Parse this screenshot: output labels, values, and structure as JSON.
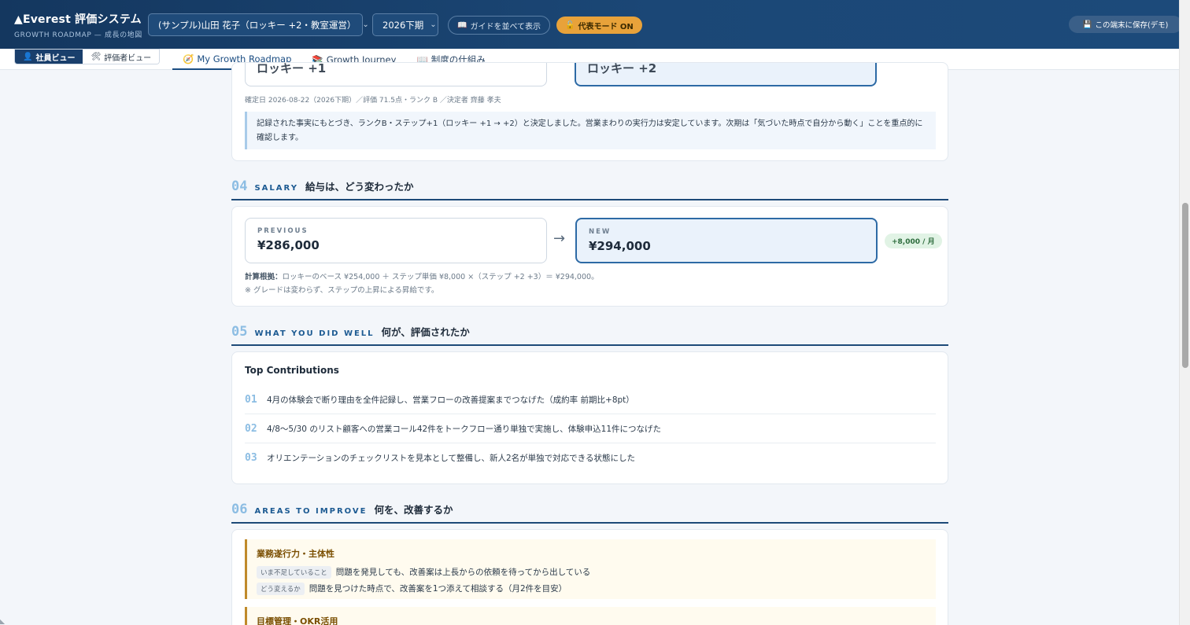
{
  "header": {
    "brand_title": "▲Everest 評価システム",
    "brand_sub": "GROWTH ROADMAP — 成長の地図",
    "employee_select": "(サンプル)山田 花子（ロッキー +2・教室運営）",
    "term_select": "2026下期",
    "guide_button": "ガイドを並べて表示",
    "rep_mode_button": "代表モード ON",
    "save_button": "この端末に保存(デモ)"
  },
  "view_toggle": {
    "employee_view": "社員ビュー",
    "evaluator_view": "評価者ビュー"
  },
  "tabs": [
    {
      "label": "My Growth Roadmap",
      "active": true
    },
    {
      "label": "Growth Journey",
      "active": false
    },
    {
      "label": "制度の仕組み",
      "active": false
    }
  ],
  "rank": {
    "previous_partial": "ロッキー +1",
    "new_partial": "ロッキー +2",
    "fixed_meta": "確定日 2026-08-22（2026下期）／評価 71.5点・ランク B ／決定者 齊藤 孝夫",
    "reason": "記録された事実にもとづき、ランクB・ステップ+1（ロッキー +1 → +2）と決定しました。営業まわりの実行力は安定しています。次期は「気づいた時点で自分から動く」ことを重点的に確認します。"
  },
  "sections": {
    "s04": {
      "num": "04",
      "en": "SALARY",
      "ja": "給与は、どう変わったか"
    },
    "s05": {
      "num": "05",
      "en": "WHAT YOU DID WELL",
      "ja": "何が、評価されたか"
    },
    "s06": {
      "num": "06",
      "en": "AREAS TO IMPROVE",
      "ja": "何を、改善するか"
    }
  },
  "salary": {
    "previous_label": "PREVIOUS",
    "previous_value": "¥286,000",
    "new_label": "NEW",
    "new_value": "¥294,000",
    "arrow": "→",
    "diff": "+8,000 / 月",
    "basis_label": "計算根拠：",
    "basis_text": "ロッキーのベース ¥254,000 ＋ ステップ単価 ¥8,000 ×（ステップ +2 +3）＝ ¥294,000。",
    "note": "※ グレードは変わらず、ステップの上昇による昇給です。"
  },
  "contributions": {
    "title": "Top Contributions",
    "items": [
      {
        "num": "01",
        "text": "4月の体験会で断り理由を全件記録し、営業フローの改善提案までつなげた（成約率 前期比+8pt）"
      },
      {
        "num": "02",
        "text": "4/8〜5/30 のリスト顧客への営業コール42件をトークフロー通り単独で実施し、体験申込11件につなげた"
      },
      {
        "num": "03",
        "text": "オリエンテーションのチェックリストを見本として整備し、新人2名が単独で対応できる状態にした"
      }
    ]
  },
  "improvements": {
    "items": [
      {
        "title": "業務遂行力・主体性",
        "current_tag": "いま不足していること",
        "current_text": "問題を発見しても、改善案は上長からの依頼を待ってから出している",
        "change_tag": "どう変えるか",
        "change_text": "問題を見つけた時点で、改善案を1つ添えて相談する（月2件を目安）"
      },
      {
        "title": "目標管理・OKR活用"
      }
    ]
  },
  "colors": {
    "header_bg": "#14375f",
    "accent": "#1d4a78",
    "rep_mode": "#e8a23a",
    "diff_bg": "#e1f3e5",
    "improve_border": "#c08a2a"
  }
}
